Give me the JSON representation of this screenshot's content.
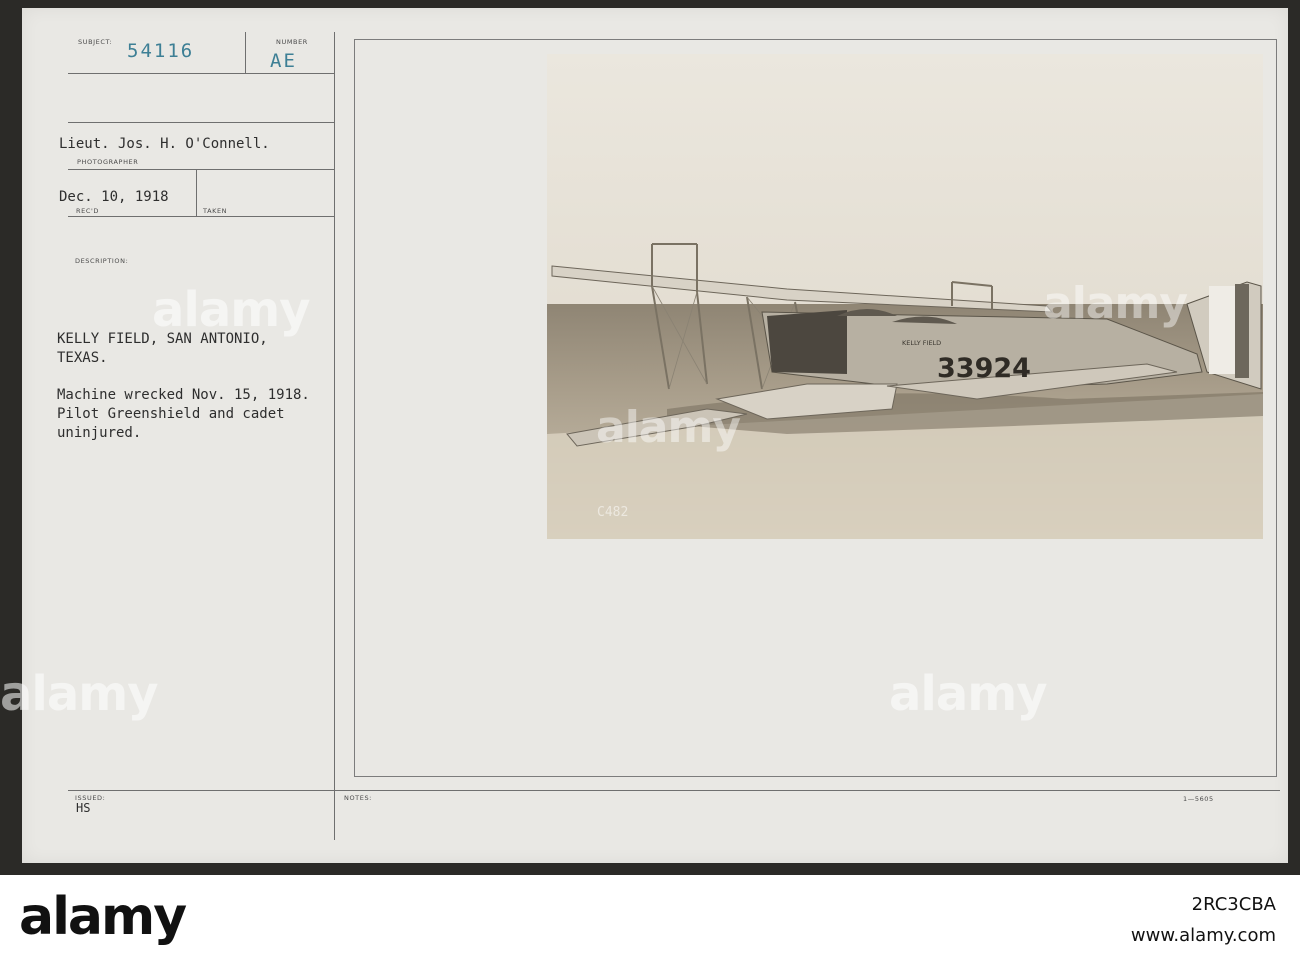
{
  "card": {
    "subject_label": "SUBJECT:",
    "subject_value": "54116",
    "number_label": "NUMBER",
    "number_value": "AE",
    "photographer_value": "Lieut. Jos. H. O'Connell.",
    "photographer_label": "PHOTOGRAPHER",
    "received_value": "Dec. 10, 1918",
    "received_label": "REC'D",
    "taken_label": "TAKEN",
    "description_label": "DESCRIPTION:",
    "description_lines": [
      "KELLY FIELD, SAN ANTONIO,",
      "TEXAS.",
      "",
      "Machine wrecked Nov. 15, 1918.",
      "Pilot Greenshield and cadet",
      "uninjured."
    ],
    "issued_label": "ISSUED:",
    "issued_value": "HS",
    "notes_label": "NOTES:",
    "form_code": "1—5605"
  },
  "photo": {
    "fuselage_text": "KELLY FIELD",
    "serial_number": "33924",
    "negative_code": "C482"
  },
  "watermark": {
    "brand": "alamy",
    "image_id": "2RC3CBA",
    "site": "www.alamy.com"
  },
  "colors": {
    "card": "#e9e8e4",
    "ink": "#2e2e2e",
    "stamp_blue": "#3d7f95",
    "photo_sepia": "#cfc8ba"
  }
}
